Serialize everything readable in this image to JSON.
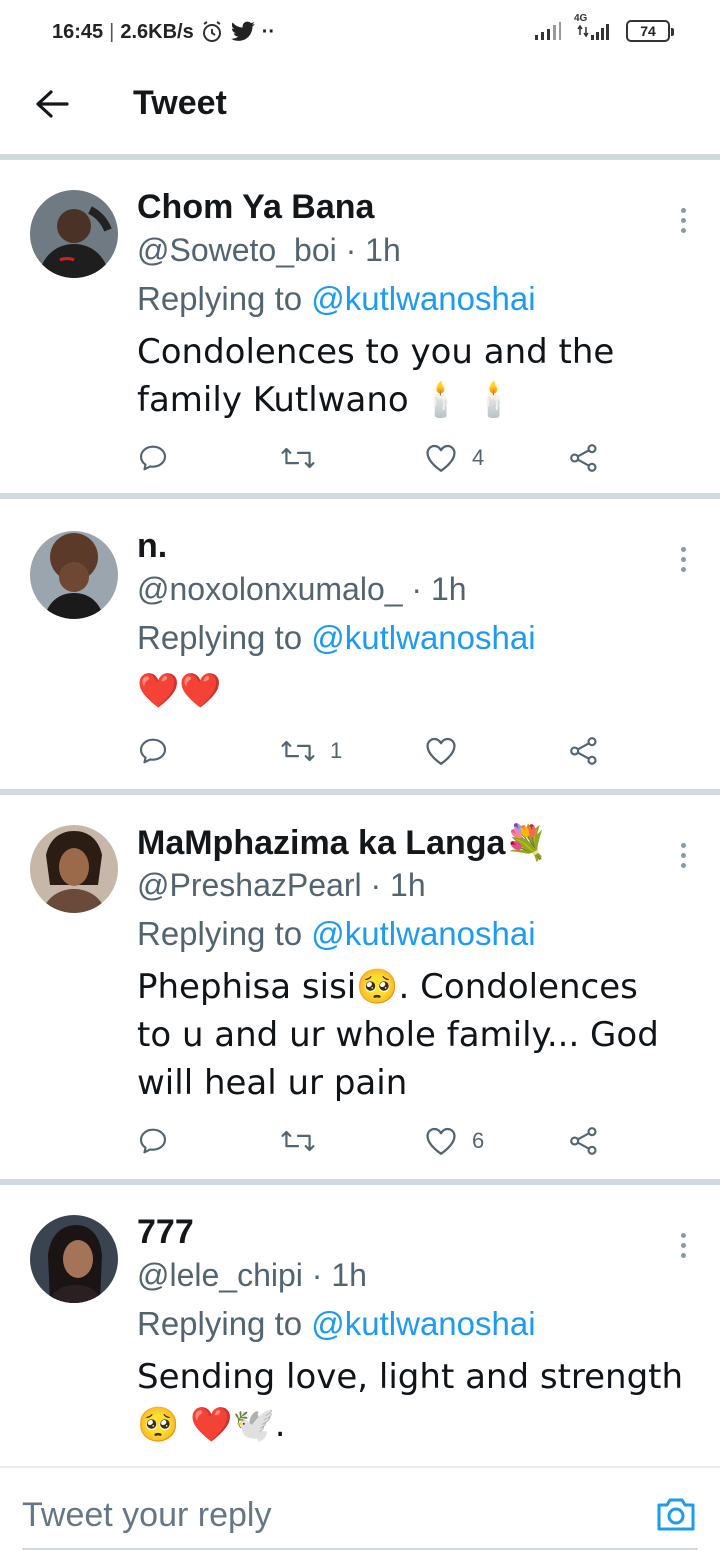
{
  "status_bar": {
    "time": "16:45",
    "separator": "|",
    "speed": "2.6KB/s",
    "more": "··",
    "network": "4G",
    "battery": "74"
  },
  "header": {
    "title": "Tweet"
  },
  "tweets": [
    {
      "name": "Chom Ya Bana",
      "name_emoji": "",
      "handle": "@Soweto_boi",
      "time": "· 1h",
      "replying_prefix": "Replying to ",
      "replying_to": "@kutlwanoshai",
      "text": "Condolences to you and the family Kutlwano 🕯️ 🕯️",
      "replies": "",
      "retweets": "",
      "likes": "4",
      "avatar_color": "#3b3b3b"
    },
    {
      "name": "n.",
      "name_emoji": "",
      "handle": "@noxolonxumalo_",
      "time": "· 1h",
      "replying_prefix": "Replying to ",
      "replying_to": "@kutlwanoshai",
      "text": "❤️❤️",
      "replies": "",
      "retweets": "1",
      "likes": "",
      "avatar_color": "#7a5a44"
    },
    {
      "name": "MaMphazima ka Langa",
      "name_emoji": "💐",
      "handle": "@PreshazPearl",
      "time": "· 1h",
      "replying_prefix": "Replying to ",
      "replying_to": "@kutlwanoshai",
      "text": "Phephisa sisi🥺. Condolences to u and ur whole family... God will heal ur pain",
      "replies": "",
      "retweets": "",
      "likes": "6",
      "avatar_color": "#8a5a3c"
    },
    {
      "name": "777",
      "name_emoji": "",
      "handle": "@lele_chipi",
      "time": "· 1h",
      "replying_prefix": "Replying to ",
      "replying_to": "@kutlwanoshai",
      "text": "Sending love, light and strength🥺 ❤️🕊️.",
      "replies": "",
      "retweets": "",
      "likes": "",
      "avatar_color": "#2e2a30"
    }
  ],
  "reply_bar": {
    "placeholder": "Tweet your reply"
  },
  "colors": {
    "accent": "#1d9bf0",
    "secondary_text": "#536471",
    "divider": "#cfd9de"
  }
}
